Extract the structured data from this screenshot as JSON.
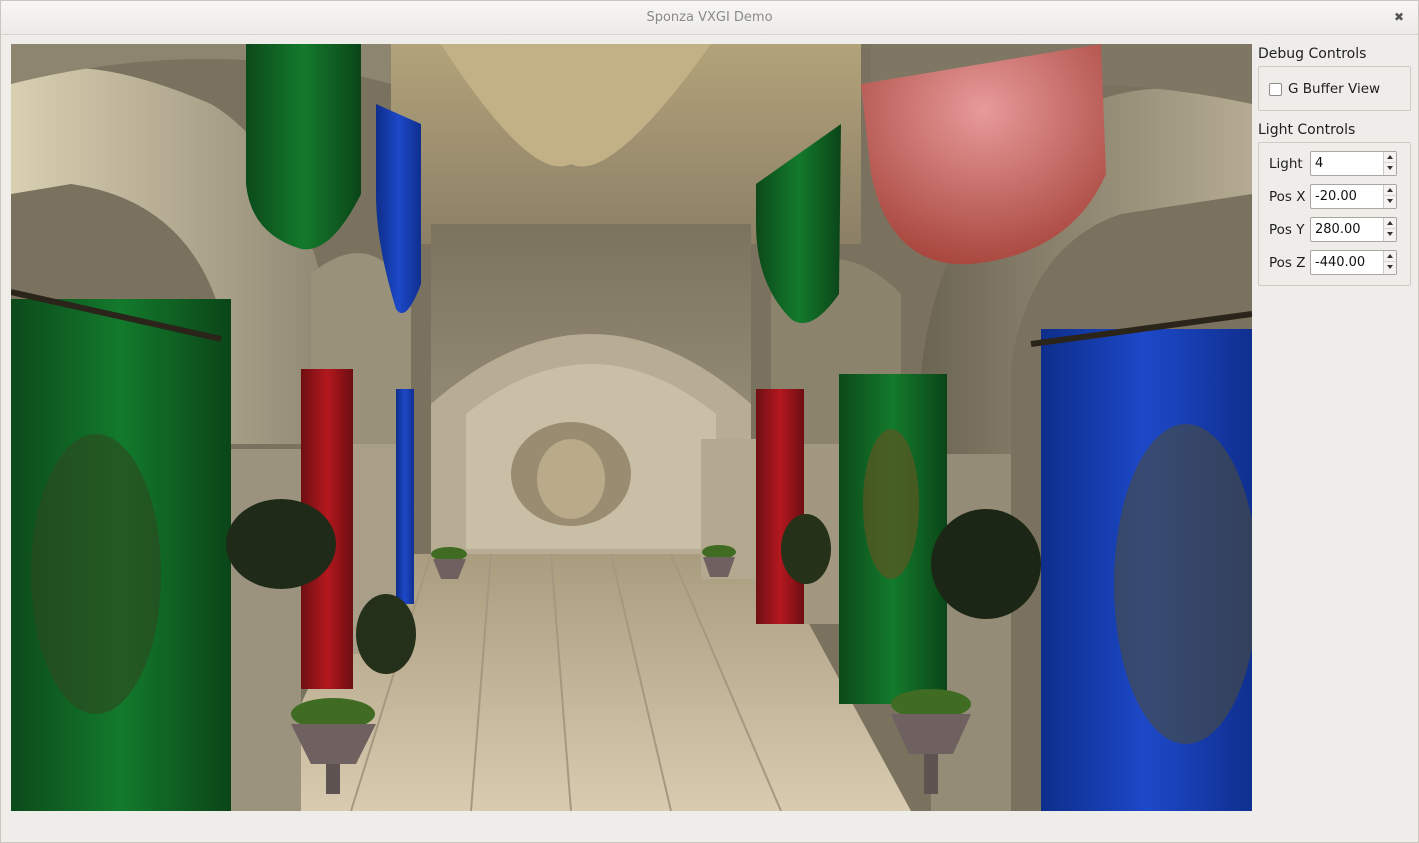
{
  "window": {
    "title": "Sponza VXGI Demo",
    "close_icon": "close-icon"
  },
  "viewport": {
    "description_icon": "rendered-3d-scene"
  },
  "debug_controls": {
    "title": "Debug Controls",
    "gbuffer_checkbox": {
      "label": "G Buffer View",
      "checked": false
    }
  },
  "light_controls": {
    "title": "Light Controls",
    "fields": [
      {
        "label": "Light",
        "value": "4"
      },
      {
        "label": "Pos X",
        "value": "-20.00"
      },
      {
        "label": "Pos Y",
        "value": "280.00"
      },
      {
        "label": "Pos Z",
        "value": "-440.00"
      }
    ]
  }
}
